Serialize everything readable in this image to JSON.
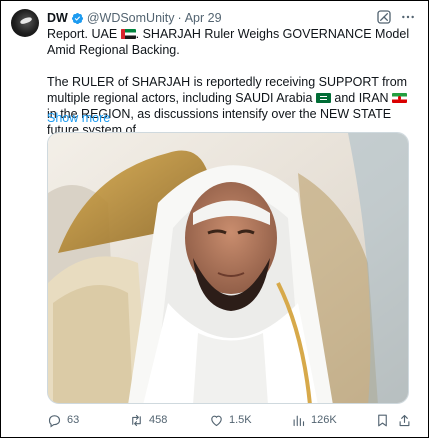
{
  "tweet": {
    "author_name": "DW",
    "handle": "@WDSomUnity",
    "separator": "·",
    "date": "Apr 29",
    "line1_part1": "Report. UAE ",
    "line1_part2": ". SHARJAH Ruler Weighs GOVERNANCE Model Amid Regional Backing.",
    "p2_part1": "The RULER of SHARJAH is reportedly receiving SUPPORT from multiple regional actors, including SAUDI Arabia ",
    "p2_part2": " and IRAN ",
    "p2_part3": " in the REGION, as discussions intensify over the NEW STATE future system of",
    "show_more": "Show more",
    "icons": {
      "verified": "verified-badge-icon",
      "grok": "grok-icon",
      "more": "more-options-icon",
      "flags": [
        "uae-flag-icon",
        "saudi-flag-icon",
        "iran-flag-icon"
      ]
    },
    "colors": {
      "accent": "#1d9bf0",
      "secondary_text": "#536471",
      "text": "#0f1419"
    }
  },
  "actions": {
    "replies": "63",
    "reposts": "458",
    "likes": "1.5K",
    "views": "126K",
    "icons": [
      "reply-icon",
      "repost-icon",
      "like-icon",
      "views-icon",
      "bookmark-icon",
      "share-icon"
    ]
  }
}
